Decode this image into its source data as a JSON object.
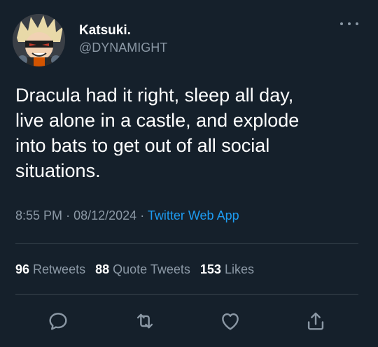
{
  "user": {
    "display_name": "Katsuki.",
    "handle": "@DYNAMIGHT"
  },
  "tweet": {
    "text": "Dracula had it right, sleep all day,\nlive alone in a castle, and explode\ninto bats to get out of all social\nsituations."
  },
  "meta": {
    "time": "8:55 PM",
    "date": "08/12/2024",
    "separator": "·",
    "source": "Twitter Web App"
  },
  "stats": {
    "retweets_count": "96",
    "retweets_label": "Retweets",
    "quotes_count": "88",
    "quotes_label": "Quote Tweets",
    "likes_count": "153",
    "likes_label": "Likes"
  },
  "icons": {
    "more": "more-icon",
    "reply": "reply-icon",
    "retweet": "retweet-icon",
    "like": "like-icon",
    "share": "share-icon"
  },
  "colors": {
    "background": "#15202b",
    "text": "#ffffff",
    "muted": "#8b98a5",
    "accent": "#1d9bf0",
    "divider": "#38444d"
  }
}
